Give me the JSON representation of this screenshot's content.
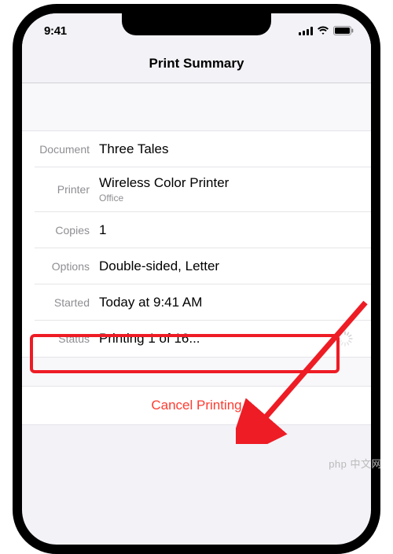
{
  "status_bar": {
    "time": "9:41"
  },
  "header": {
    "title": "Print Summary"
  },
  "rows": {
    "document": {
      "label": "Document",
      "value": "Three Tales"
    },
    "printer": {
      "label": "Printer",
      "value": "Wireless Color Printer",
      "sub": "Office"
    },
    "copies": {
      "label": "Copies",
      "value": "1"
    },
    "options": {
      "label": "Options",
      "value": "Double-sided, Letter"
    },
    "started": {
      "label": "Started",
      "value": "Today at 9:41 AM"
    },
    "status": {
      "label": "Status",
      "value": "Printing 1 of 16..."
    }
  },
  "cancel": {
    "label": "Cancel Printing"
  },
  "watermark": "php 中文网"
}
